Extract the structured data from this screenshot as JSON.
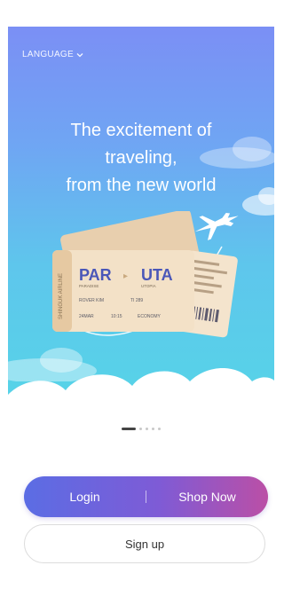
{
  "hero": {
    "language_label": "LANGUAGE",
    "headline": [
      "The excitement of",
      "traveling,",
      "from the new world"
    ]
  },
  "ticket": {
    "from_code": "PAR",
    "from_city": "PARADISE",
    "to_code": "UTA",
    "to_city": "UTOPIA",
    "passenger": "ROVER KIM",
    "flight": "TI 289",
    "date": "24MAR",
    "gate": "10:15",
    "class": "ECONOMY",
    "side_text": "SHINGUK AIRLINE"
  },
  "pager": {
    "count": 5,
    "active_index": 0
  },
  "actions": {
    "login_label": "Login",
    "shop_label": "Shop Now",
    "signup_label": "Sign up"
  },
  "colors": {
    "hero_top": "#7b8ff5",
    "hero_bottom": "#55d6e7",
    "cta_start": "#5b6de4",
    "cta_end": "#bb4fa6",
    "ticket": "#f3e1c7",
    "ticket_text": "#4a57b8"
  }
}
